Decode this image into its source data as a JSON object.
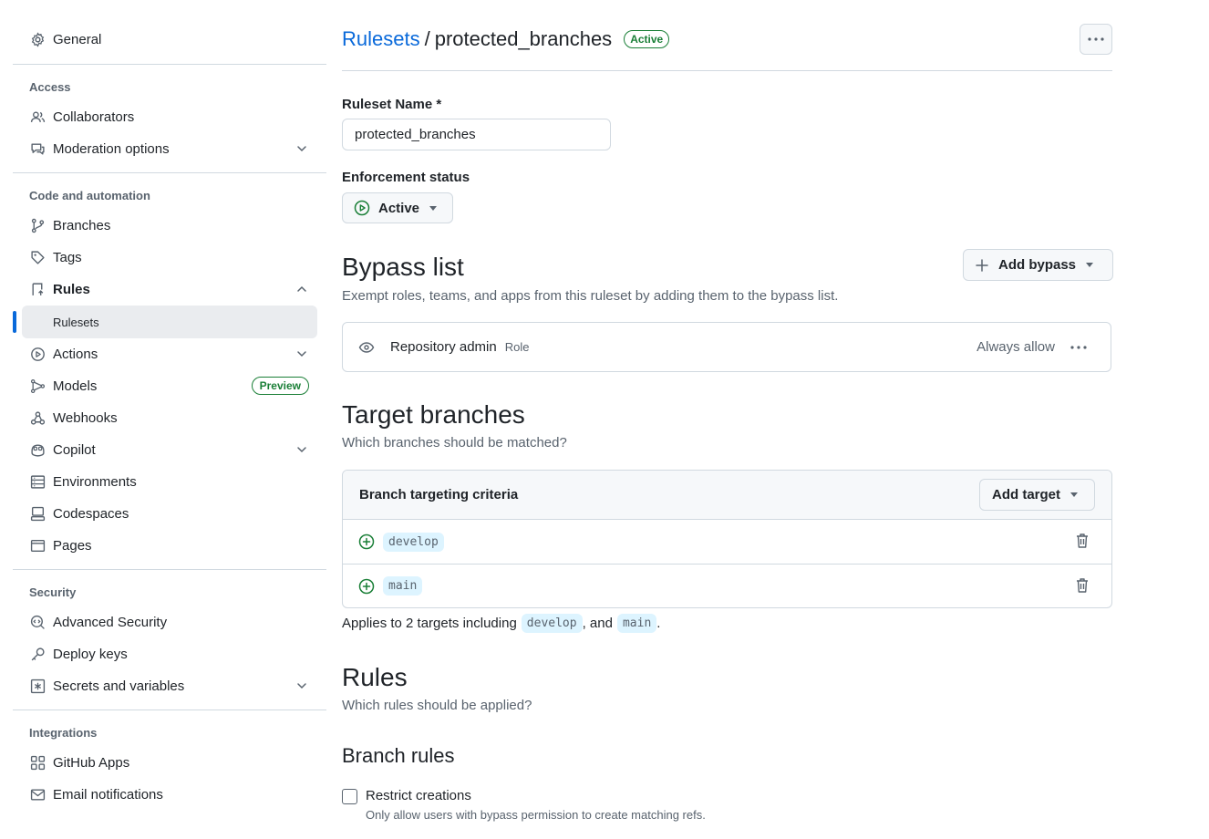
{
  "sidebar": {
    "general": "General",
    "sections": {
      "access": "Access",
      "code_automation": "Code and automation",
      "security": "Security",
      "integrations": "Integrations"
    },
    "items": {
      "collaborators": "Collaborators",
      "moderation": "Moderation options",
      "branches": "Branches",
      "tags": "Tags",
      "rules": "Rules",
      "rulesets": "Rulesets",
      "actions": "Actions",
      "models": "Models",
      "models_badge": "Preview",
      "webhooks": "Webhooks",
      "copilot": "Copilot",
      "environments": "Environments",
      "codespaces": "Codespaces",
      "pages": "Pages",
      "advanced_security": "Advanced Security",
      "deploy_keys": "Deploy keys",
      "secrets": "Secrets and variables",
      "github_apps": "GitHub Apps",
      "email_notifications": "Email notifications"
    }
  },
  "header": {
    "breadcrumb_link": "Rulesets",
    "separator": "/",
    "title": "protected_branches",
    "status_badge": "Active"
  },
  "form": {
    "name_label": "Ruleset Name *",
    "name_value": "protected_branches",
    "enforcement_label": "Enforcement status",
    "enforcement_value": "Active"
  },
  "bypass": {
    "title": "Bypass list",
    "description": "Exempt roles, teams, and apps from this ruleset by adding them to the bypass list.",
    "add_button": "Add bypass",
    "entries": [
      {
        "name": "Repository admin",
        "type": "Role",
        "mode": "Always allow"
      }
    ]
  },
  "targets": {
    "title": "Target branches",
    "description": "Which branches should be matched?",
    "criteria_label": "Branch targeting criteria",
    "add_button": "Add target",
    "items": [
      "develop",
      "main"
    ],
    "summary_prefix": "Applies to 2 targets including",
    "summary_chip1": "develop",
    "summary_mid": ", and",
    "summary_chip2": "main",
    "summary_end": "."
  },
  "rules": {
    "title": "Rules",
    "description": "Which rules should be applied?",
    "branch_rules_title": "Branch rules",
    "restrict_creations_label": "Restrict creations",
    "restrict_creations_desc": "Only allow users with bypass permission to create matching refs."
  },
  "colors": {
    "accent": "#0969da",
    "success": "#1a7f37",
    "border": "#d1d9e0",
    "muted": "#59636e"
  }
}
